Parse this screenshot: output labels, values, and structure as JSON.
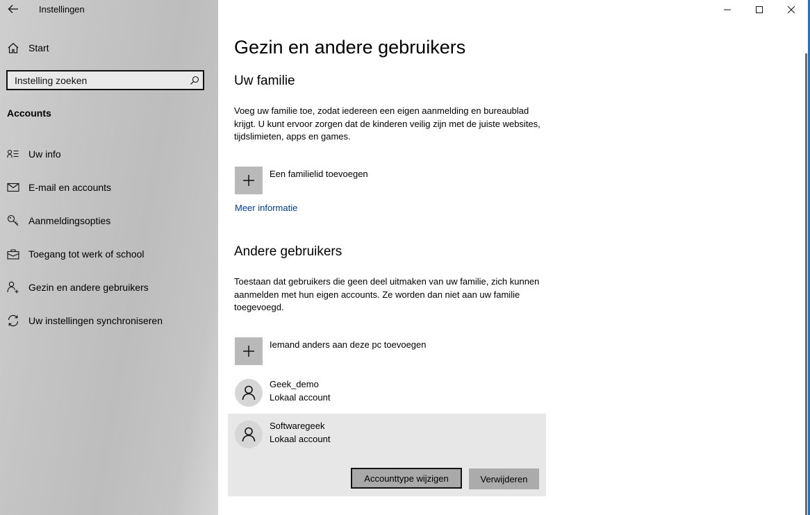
{
  "window": {
    "title": "Instellingen",
    "controls": {
      "minimize": "minimize-icon",
      "maximize": "maximize-icon",
      "close": "close-icon"
    }
  },
  "sidebar": {
    "back_icon": "arrow-left-icon",
    "home": {
      "label": "Start",
      "icon": "home-icon"
    },
    "search": {
      "placeholder": "Instelling zoeken",
      "value": "",
      "icon": "search-icon"
    },
    "section_label": "Accounts",
    "items": [
      {
        "label": "Uw info",
        "icon": "contact-info-icon"
      },
      {
        "label": "E-mail en accounts",
        "icon": "mail-icon"
      },
      {
        "label": "Aanmeldingsopties",
        "icon": "key-icon"
      },
      {
        "label": "Toegang tot werk of school",
        "icon": "briefcase-icon"
      },
      {
        "label": "Gezin en andere gebruikers",
        "icon": "add-person-icon",
        "selected": true
      },
      {
        "label": "Uw instellingen synchroniseren",
        "icon": "sync-icon"
      }
    ]
  },
  "main": {
    "title": "Gezin en andere gebruikers",
    "family": {
      "heading": "Uw familie",
      "description": "Voeg uw familie toe, zodat iedereen een eigen aanmelding en bureaublad krijgt. U kunt ervoor zorgen dat de kinderen veilig zijn met de juiste websites, tijdslimieten, apps en games.",
      "add_label": "Een familielid toevoegen",
      "more_info_link": "Meer informatie"
    },
    "others": {
      "heading": "Andere gebruikers",
      "description": "Toestaan dat gebruikers die geen deel uitmaken van uw familie, zich kunnen aanmelden met hun eigen accounts. Ze worden dan niet aan uw familie toegevoegd.",
      "add_label": "Iemand anders aan deze pc toevoegen",
      "users": [
        {
          "name": "Geek_demo",
          "type": "Lokaal account"
        },
        {
          "name": "Softwaregeek",
          "type": "Lokaal account",
          "selected": true
        }
      ],
      "actions": {
        "change_type": "Accounttype wijzigen",
        "remove": "Verwijderen"
      }
    }
  },
  "colors": {
    "link": "#003e92",
    "accent_edge": "#2a6fb5"
  }
}
